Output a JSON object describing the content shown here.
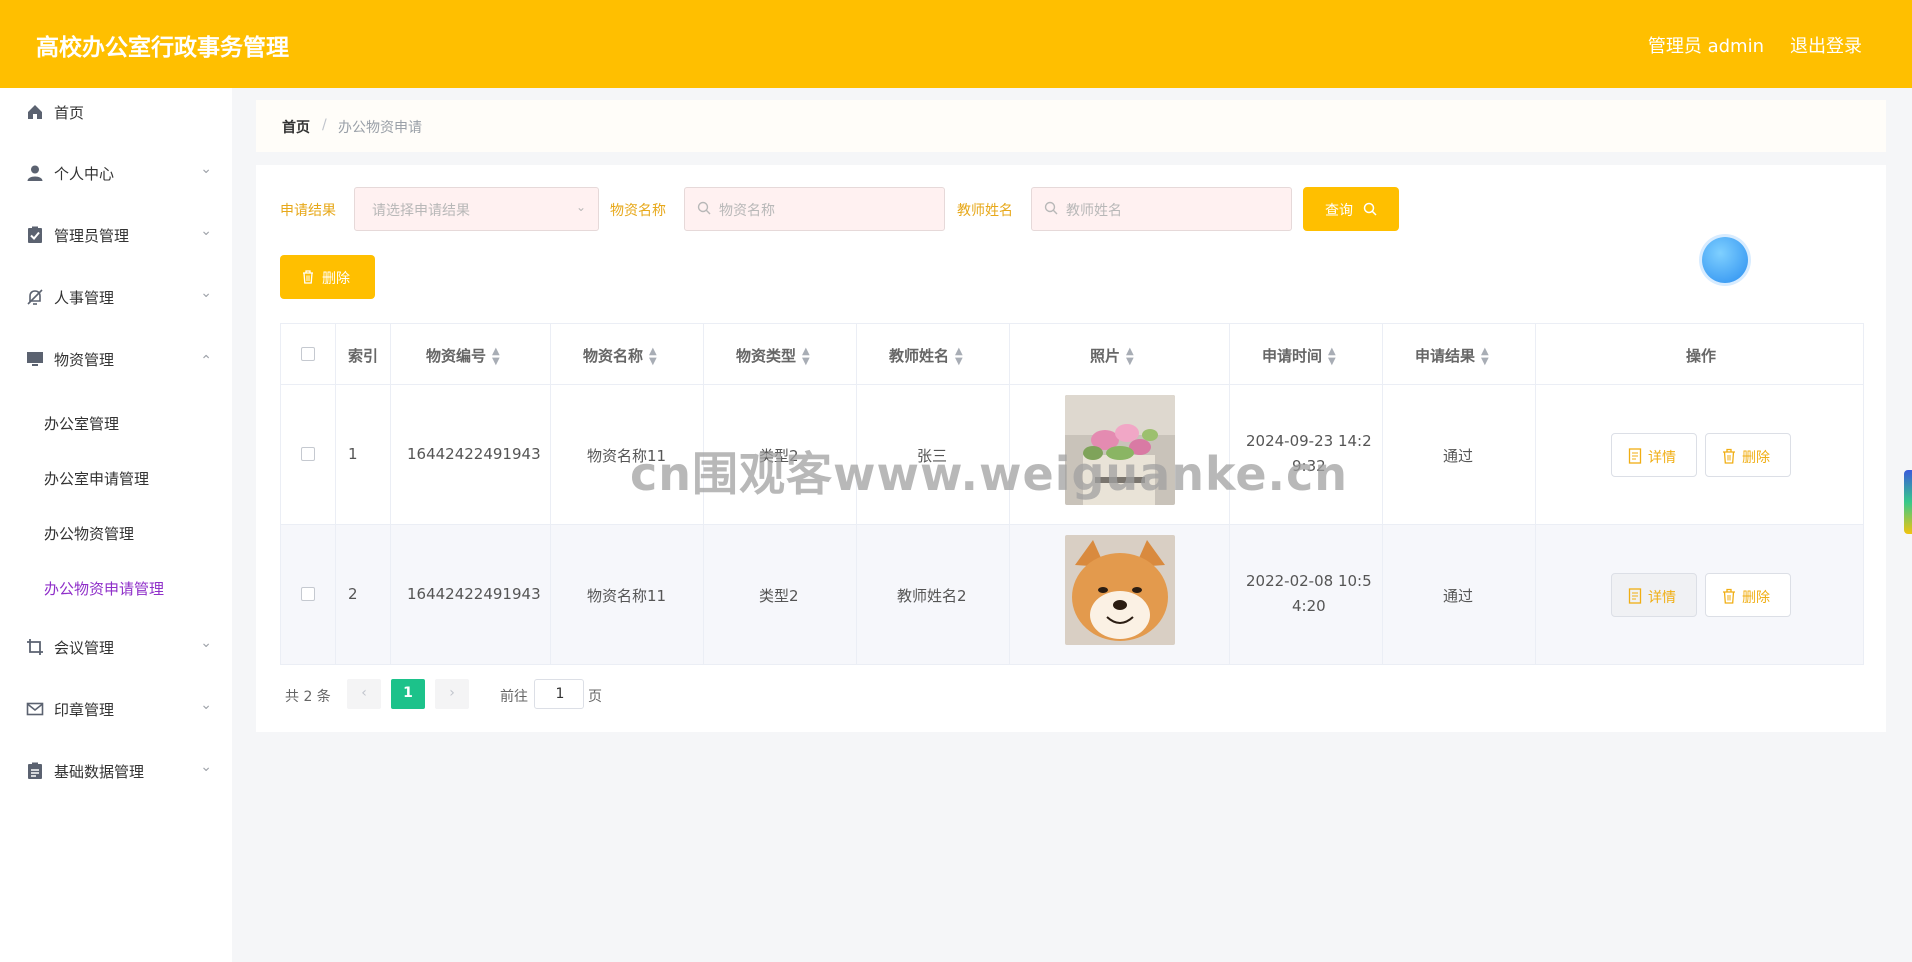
{
  "header": {
    "title": "高校办公室行政事务管理",
    "user": "管理员 admin",
    "logout": "退出登录"
  },
  "sidebar": {
    "items": [
      {
        "label": "首页",
        "icon": "home-icon"
      },
      {
        "label": "个人中心",
        "icon": "user-icon"
      },
      {
        "label": "管理员管理",
        "icon": "clipboard-check-icon"
      },
      {
        "label": "人事管理",
        "icon": "bell-off-icon"
      },
      {
        "label": "物资管理",
        "icon": "monitor-icon"
      },
      {
        "label": "会议管理",
        "icon": "crop-icon"
      },
      {
        "label": "印章管理",
        "icon": "mail-icon"
      },
      {
        "label": "基础数据管理",
        "icon": "clipboard-icon"
      }
    ],
    "submenu": [
      {
        "label": "办公室管理"
      },
      {
        "label": "办公室申请管理"
      },
      {
        "label": "办公物资管理"
      },
      {
        "label": "办公物资申请管理"
      }
    ]
  },
  "breadcrumb": {
    "home": "首页",
    "separator": "/",
    "current": "办公物资申请"
  },
  "filters": {
    "result_label": "申请结果",
    "result_placeholder": "请选择申请结果",
    "name_label": "物资名称",
    "name_placeholder": "物资名称",
    "teacher_label": "教师姓名",
    "teacher_placeholder": "教师姓名",
    "query_button": "查询"
  },
  "toolbar": {
    "delete_button": "删除"
  },
  "table": {
    "columns": [
      "索引",
      "物资编号",
      "物资名称",
      "物资类型",
      "教师姓名",
      "照片",
      "申请时间",
      "申请结果",
      "操作"
    ],
    "rows": [
      {
        "index": "1",
        "code": "16442422491943",
        "name": "物资名称11",
        "type": "类型2",
        "teacher": "张三",
        "photo": "flower-photo",
        "time_line1": "2024-09-23 14:2",
        "time_line2": "9:32",
        "result": "通过"
      },
      {
        "index": "2",
        "code": "16442422491943",
        "name": "物资名称11",
        "type": "类型2",
        "teacher": "教师姓名2",
        "photo": "dog-photo",
        "time_line1": "2022-02-08 10:5",
        "time_line2": "4:20",
        "result": "通过"
      }
    ],
    "detail_button": "详情",
    "delete_button": "删除"
  },
  "pagination": {
    "total": "共 2 条",
    "current": "1",
    "goto_prefix": "前往",
    "goto_value": "1",
    "goto_suffix": "页"
  },
  "watermark": "cn围观客www.weiguanke.cn",
  "colors": {
    "accent": "#ffbf00",
    "active_menu": "#8f2fc9",
    "pager_active": "#1cc28a"
  }
}
